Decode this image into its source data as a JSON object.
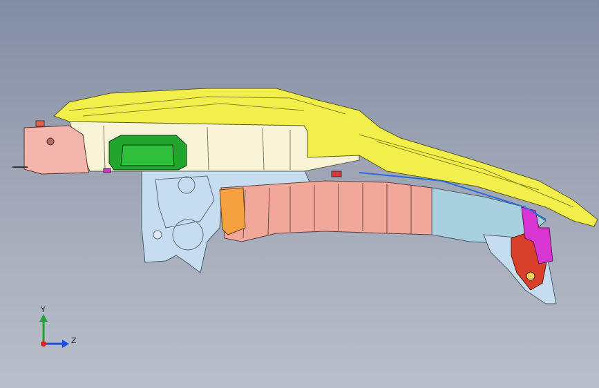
{
  "viewport": {
    "background_top": "#828ca3",
    "background_bottom": "#b9bfca"
  },
  "model": {
    "description_colors": {
      "upper_panel": "#f0ee4a",
      "tank": "#f6f3d6",
      "green_part": "#1fa52b",
      "pink_box": "#f3b2a7",
      "frame_blue": "#c9dff0",
      "salmon_rail": "#f09f95",
      "orange_bracket": "#f6a23a",
      "magenta_bracket": "#d632d3",
      "red_bracket": "#d83a2a"
    }
  },
  "triad": {
    "y_label": "Y",
    "z_label": "Z",
    "y_color": "#23a23a",
    "z_color": "#1d4fd8",
    "x_color": "#e0201b"
  }
}
